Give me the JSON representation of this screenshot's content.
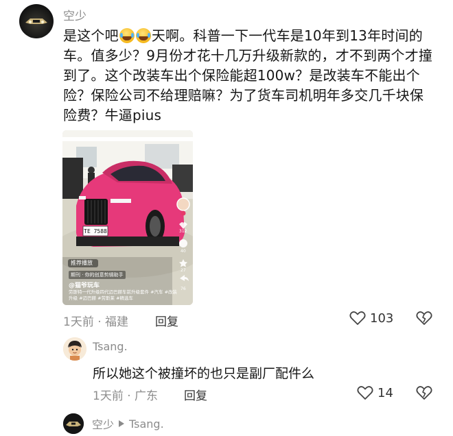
{
  "comment_main": {
    "username": "空少",
    "text_part1": "是这个吧",
    "text_part2": "天啊。科普一下一代车是10年到13年时间的车。值多少？9月份才花十几万升级新款的，才不到两个才撞到了。这个改装车出个保险能超100w？是改装车不能出个险？保险公司不给理赔嘛？为了货车司机明年多交几千块保险费？牛逼pius",
    "time_location": "1天前 · 福建",
    "reply_label": "回复",
    "likes": "103",
    "media": {
      "tag_chip": "推荐播放",
      "handle": "@猫爷玩车",
      "meta_line": "期刊 · 你的创意剪辑助手",
      "caption": "劳斯特一代升级四代迈巴赫车前升级套件 #汽车 #改装升级 #迈巴赫 #劳斯莱 #精选车",
      "plate": "TE 7588",
      "stat_like": "312",
      "stat_comment": "40",
      "stat_star": "27",
      "stat_share": "76"
    }
  },
  "comment_reply": {
    "username": "Tsang.",
    "text": "所以她这个被撞坏的也只是副厂配件么",
    "time_location": "1天前 · 广东",
    "reply_label": "回复",
    "likes": "14"
  },
  "comment_nested": {
    "username": "空少",
    "reply_to": "Tsang."
  },
  "colors": {
    "car_pink": "#e6397a",
    "meta_gray": "#8d8d8d",
    "icon_gray": "#444444"
  }
}
